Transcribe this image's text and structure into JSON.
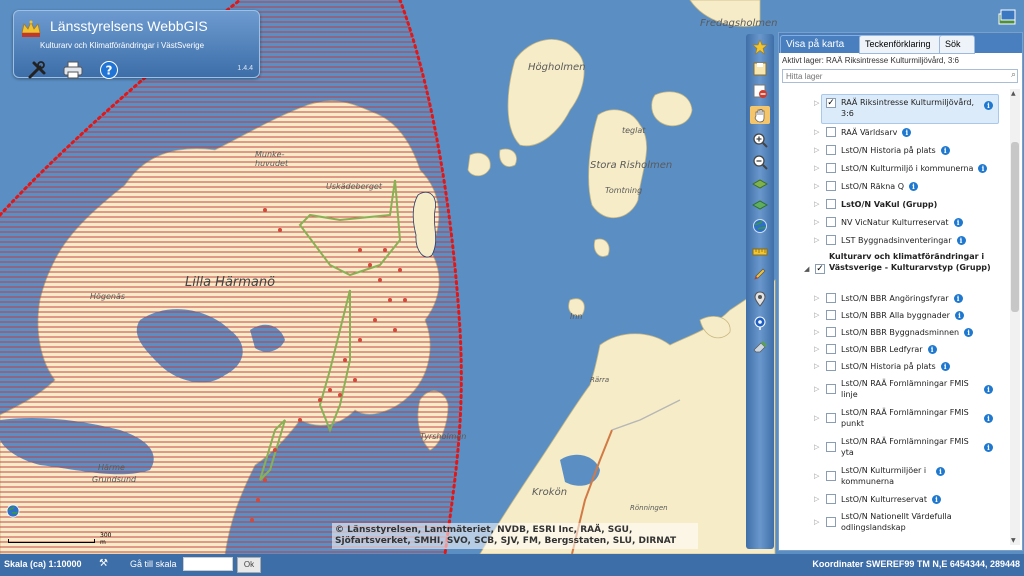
{
  "header": {
    "title": "Länsstyrelsens WebbGIS",
    "subtitle": "Kulturarv och Klimatförändringar i VästSverige",
    "version": "1.4.4",
    "tools": [
      "tools-icon",
      "print-icon",
      "help-icon"
    ]
  },
  "map": {
    "labels": {
      "fredagsholmen": "Fredagsholmen",
      "hogholmen": "Högholmen",
      "lilla_harmano": "Lilla Härmanö",
      "stora_risholmen": "Stora Risholmen",
      "tomtning": "Tomtning",
      "uskadeberget": "Uskädeberget",
      "munkeholm": "Munke-\nhuvudet",
      "hogenas": "Högenäs",
      "harme": "Härme",
      "grundsund": "Grundsund",
      "krokon": "Krokön",
      "tyrsholmen": "Tyrsholmen",
      "inn": "Inn",
      "teglat": "teglat",
      "rarra": "Rärra",
      "runningen": "Rönningen"
    },
    "scalebar": "300 m",
    "copyright": "© Länsstyrelsen, Lantmäteriet, NVDB, ESRI Inc, RAÄ, SGU, Sjöfartsverket, SMHI, SVO, SCB, SJV, FM, Bergsstaten, SLU, DIRNAT"
  },
  "panel": {
    "tabs": [
      "Visa på karta",
      "Teckenförklaring",
      "Sök"
    ],
    "active_layer": "Aktivt lager:  RAÄ Riksintresse Kulturmiljövård, 3:6",
    "search_placeholder": "Hitta lager",
    "layers": [
      {
        "label": "RAÄ Riksintresse Kulturmiljövård, 3:6",
        "checked": true,
        "selected": true
      },
      {
        "label": "RAÄ Världsarv",
        "checked": false
      },
      {
        "label": "LstO/N Historia på plats",
        "checked": false
      },
      {
        "label": "LstO/N Kulturmiljö i kommunerna",
        "checked": false
      },
      {
        "label": "LstO/N Räkna Q",
        "checked": false
      },
      {
        "label": "LstO/N VaKul (Grupp)",
        "checked": false,
        "group": true
      },
      {
        "label": "NV VicNatur Kulturreservat",
        "checked": false
      },
      {
        "label": "LST Byggnadsinventeringar",
        "checked": false
      },
      {
        "label": "Kulturarv och klimatförändringar i Västsverige - Kulturarvstyp (Grupp)",
        "checked": true,
        "group": true,
        "expanded": true
      },
      {
        "label": "LstO/N BBR Angöringsfyrar",
        "checked": false
      },
      {
        "label": "LstO/N BBR Alla byggnader",
        "checked": false
      },
      {
        "label": "LstO/N BBR Byggnadsminnen",
        "checked": false
      },
      {
        "label": "LstO/N BBR Ledfyrar",
        "checked": false
      },
      {
        "label": "LstO/N Historia på plats",
        "checked": false
      },
      {
        "label": "LstO/N RAÄ Fornlämningar FMIS linje",
        "checked": false
      },
      {
        "label": "LstO/N RAÄ Fornlämningar FMIS punkt",
        "checked": false
      },
      {
        "label": "LstO/N RAÄ Fornlämningar FMIS yta",
        "checked": false
      },
      {
        "label": "LstO/N Kulturmiljöer i kommunerna",
        "checked": false
      },
      {
        "label": "LstO/N Kulturreservat",
        "checked": false
      },
      {
        "label": "LstO/N Nationellt Värdefulla odlingslandskap",
        "checked": false
      }
    ]
  },
  "statusbar": {
    "scale": "Skala (ca) 1:10000",
    "goto_label": "Gå till skala",
    "ok": "Ok",
    "coordinates": "Koordinater SWEREF99 TM N,E 6454344, 289448"
  }
}
